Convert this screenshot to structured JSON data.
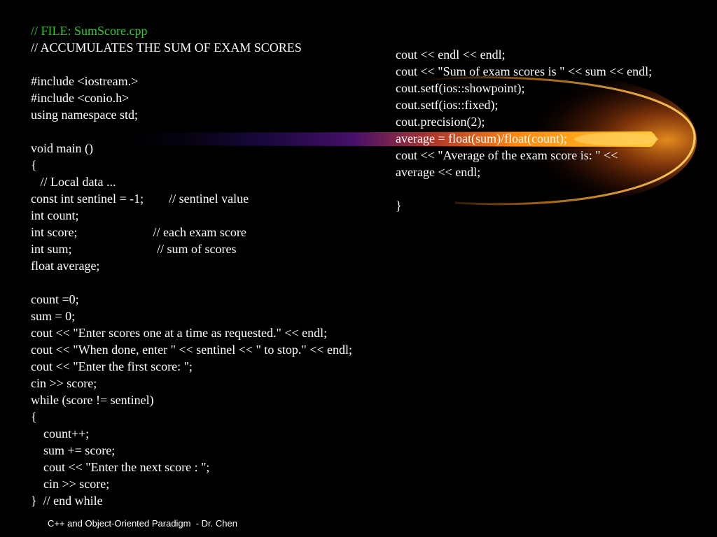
{
  "slide": {
    "background": "#000000",
    "title_color": "#33cc33",
    "left_code": {
      "lines": [
        "// FILE: SumScore.cpp",
        "// ACCUMULATES THE SUM OF EXAM SCORES",
        "",
        "#include <iostream.>",
        "#include <conio.h>",
        "using namespace std;",
        "",
        "void main ()",
        "{",
        "   // Local data ...",
        "const int sentinel = -1;        // sentinel value",
        "int count;",
        "int score;                        // each exam score",
        "int sum;                           // sum of scores",
        "float average;",
        "",
        "count =0;",
        "sum = 0;",
        "cout << \"Enter scores one at a time as requested.\" << endl;",
        "cout << \"When done, enter \" << sentinel << \" to stop.\" << endl;",
        "cout << \"Enter the first score: \";",
        "cin >> score;",
        "while (score != sentinel)",
        "{",
        "    count++;",
        "    sum += score;",
        "    cout << \"Enter the next score : \";",
        "    cin >> score;",
        "}  // end while"
      ]
    },
    "right_code": {
      "lines": [
        "cout << endl << endl;",
        "cout << \"Sum of exam scores is \" << sum << endl;",
        "cout.setf(ios::showpoint);",
        "cout.setf(ios::fixed);",
        "cout.precision(2);",
        "average = float(sum)/float(count);",
        "cout << \"Average of the exam score is: \" <<",
        "average << endl;",
        "",
        "}"
      ]
    },
    "footer": "C++ and Object-Oriented Paradigm  - Dr. Chen"
  }
}
